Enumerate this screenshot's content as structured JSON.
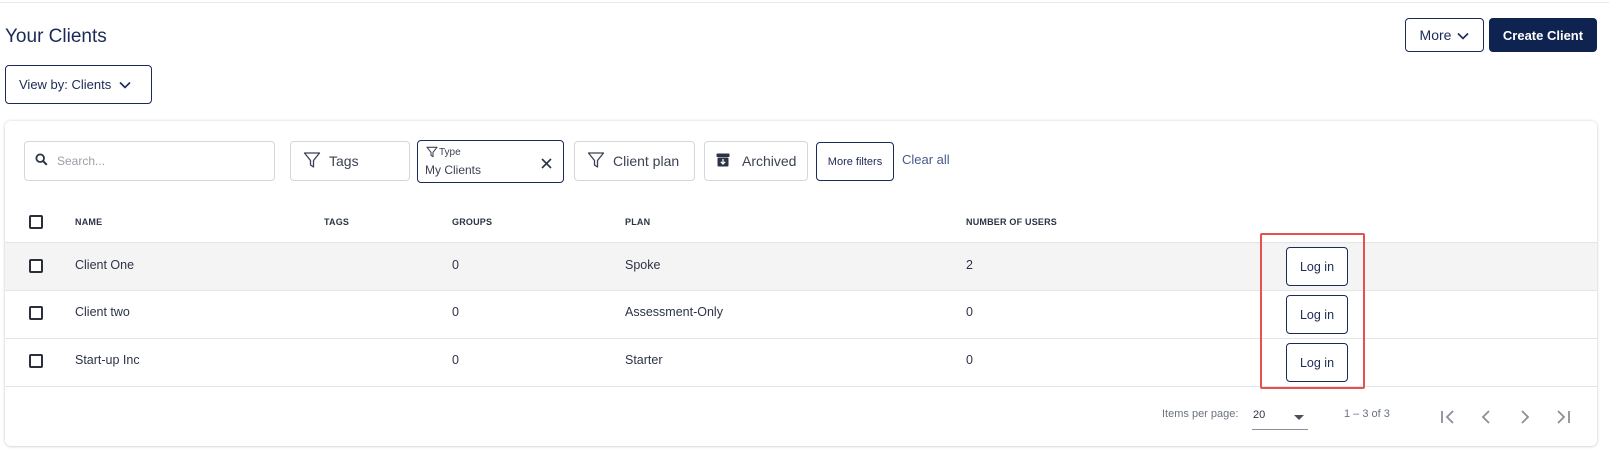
{
  "page": {
    "title": "Your Clients"
  },
  "header_actions": {
    "more_label": "More",
    "create_label": "Create Client"
  },
  "view_by": {
    "label": "View by: Clients"
  },
  "filters": {
    "search_placeholder": "Search...",
    "tags_label": "Tags",
    "type_label": "Type",
    "type_value": "My Clients",
    "client_plan_label": "Client plan",
    "archived_label": "Archived",
    "more_filters_label": "More filters",
    "clear_all_label": "Clear all"
  },
  "table": {
    "columns": {
      "name": "NAME",
      "tags": "TAGS",
      "groups": "GROUPS",
      "plan": "PLAN",
      "users": "NUMBER OF USERS"
    },
    "rows": [
      {
        "name": "Client One",
        "tags": "",
        "groups": "0",
        "plan": "Spoke",
        "users": "2",
        "action": "Log in"
      },
      {
        "name": "Client two",
        "tags": "",
        "groups": "0",
        "plan": "Assessment-Only",
        "users": "0",
        "action": "Log in"
      },
      {
        "name": "Start-up Inc",
        "tags": "",
        "groups": "0",
        "plan": "Starter",
        "users": "0",
        "action": "Log in"
      }
    ]
  },
  "pagination": {
    "items_per_page_label": "Items per page:",
    "items_per_page_value": "20",
    "range_label": "1 – 3 of 3"
  },
  "colors": {
    "primary": "#0f2350",
    "highlight": "#e4514f",
    "row_hover": "#f4f4f4"
  },
  "icons": [
    "search-icon",
    "filter-icon",
    "archive-icon",
    "chevron-down-icon",
    "close-icon",
    "first-page-icon",
    "prev-page-icon",
    "next-page-icon",
    "last-page-icon"
  ]
}
